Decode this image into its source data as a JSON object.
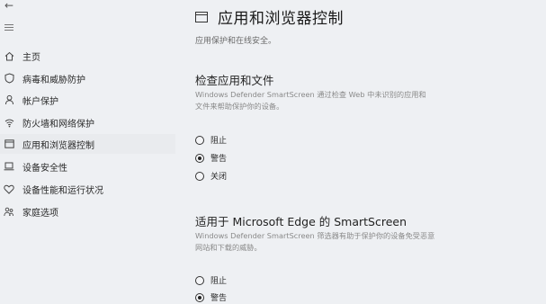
{
  "window": {
    "back_symbol": "←"
  },
  "sidebar": {
    "items": [
      {
        "label": "主页",
        "icon": "home-icon"
      },
      {
        "label": "病毒和威胁防护",
        "icon": "shield-icon"
      },
      {
        "label": "帐户保护",
        "icon": "person-icon"
      },
      {
        "label": "防火墙和网络保护",
        "icon": "wifi-icon"
      },
      {
        "label": "应用和浏览器控制",
        "icon": "app-window-icon"
      },
      {
        "label": "设备安全性",
        "icon": "laptop-icon"
      },
      {
        "label": "设备性能和运行状况",
        "icon": "heart-icon"
      },
      {
        "label": "家庭选项",
        "icon": "family-icon"
      }
    ],
    "active_index": 4
  },
  "main": {
    "title": "应用和浏览器控制",
    "subtitle": "应用保护和在线安全。",
    "sections": [
      {
        "heading": "检查应用和文件",
        "description_line1": "Windows Defender SmartScreen 通过检查 Web 中未识别的应用和",
        "description_line2": "文件来帮助保护你的设备。",
        "options": [
          "阻止",
          "警告",
          "关闭"
        ],
        "selected": 1
      },
      {
        "heading": "适用于 Microsoft Edge 的 SmartScreen",
        "description_line1": "Windows Defender SmartScreen 筛选器有助于保护你的设备免受恶意",
        "description_line2": "网站和下载的威胁。",
        "options": [
          "阻止",
          "警告"
        ],
        "selected": 1
      }
    ]
  },
  "colors": {
    "background": "#eef0f3",
    "text": "#1f1f1f",
    "muted": "#8a8a8a"
  }
}
